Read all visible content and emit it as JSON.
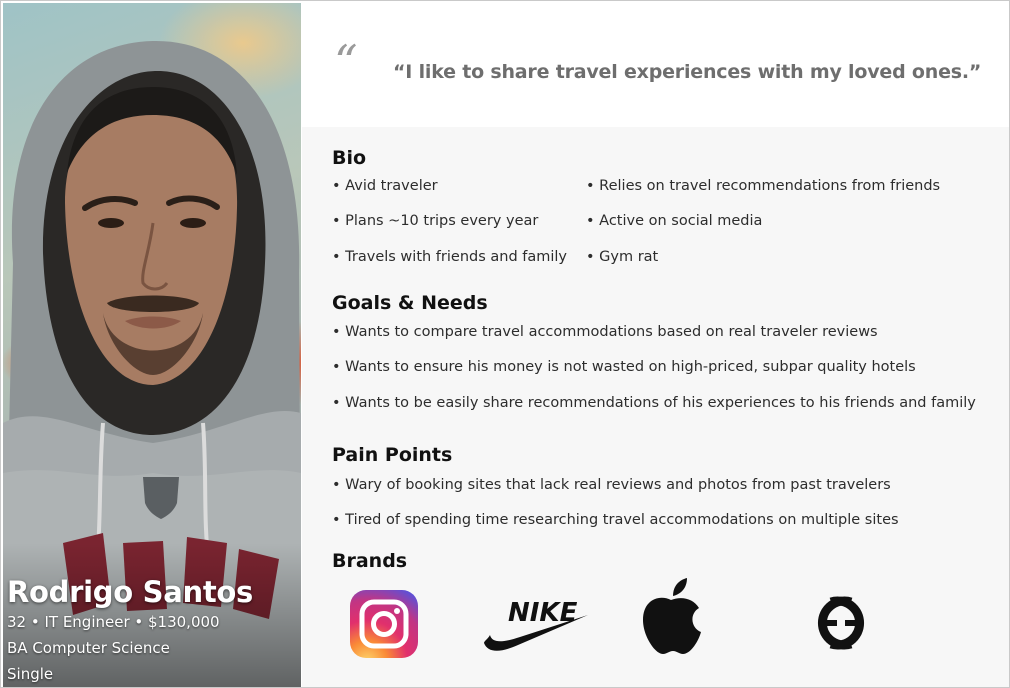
{
  "persona": {
    "name": "Rodrigo Santos",
    "details": "32 • IT Engineer • $130,000",
    "education": "BA Computer Science",
    "status": "Single"
  },
  "quote": {
    "mark": "“",
    "text": "“I like to share travel experiences with my loved ones.”"
  },
  "bio": {
    "title": "Bio",
    "col1": [
      "• Avid traveler",
      "• Plans ~10 trips every year",
      "• Travels with friends and family"
    ],
    "col2": [
      "• Relies on travel recommendations from friends",
      "• Active on social media",
      "• Gym rat"
    ]
  },
  "goals": {
    "title": "Goals & Needs",
    "items": [
      "• Wants to compare travel accommodations based on real traveler reviews",
      "• Wants to ensure his money is not wasted on high-priced, subpar quality hotels",
      "• Wants to be easily share recommendations of his experiences to his friends and family"
    ]
  },
  "pains": {
    "title": "Pain Points",
    "items": [
      "• Wary of booking sites that lack real reviews and photos from past travelers",
      "• Tired of spending time researching travel accommodations on multiple sites"
    ]
  },
  "brands": {
    "title": "Brands",
    "logos": [
      {
        "icon": "instagram-logo"
      },
      {
        "icon": "nike-logo",
        "wordmark": "NIKE"
      },
      {
        "icon": "apple-logo"
      },
      {
        "icon": "gucci-logo"
      }
    ]
  },
  "colors": {
    "content_bg": "#f7f7f7",
    "quote_text": "#6e6e6e",
    "heading": "#111111"
  }
}
